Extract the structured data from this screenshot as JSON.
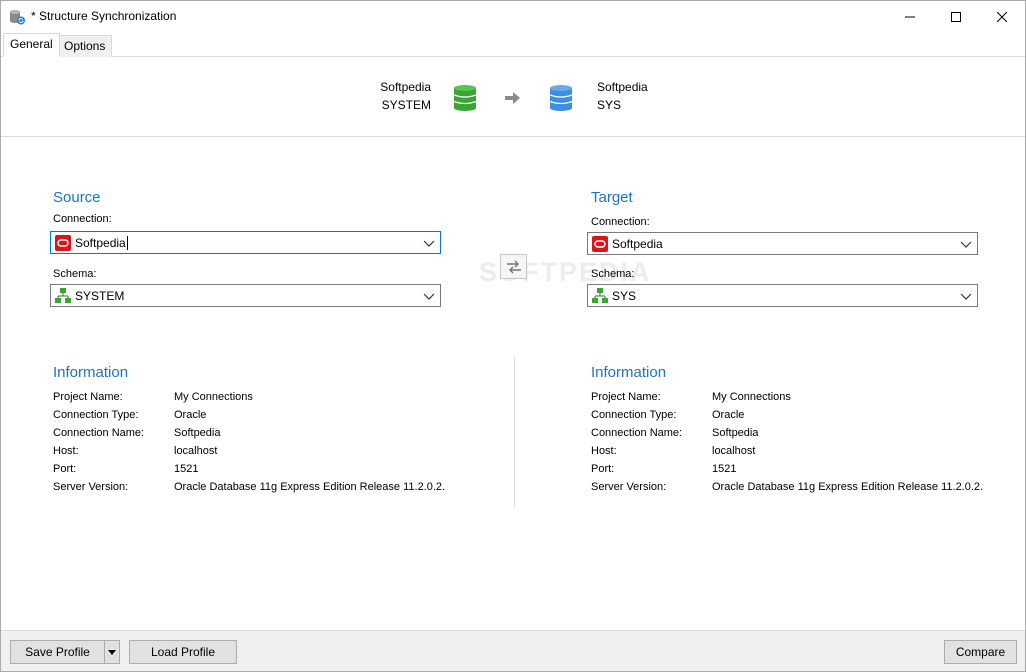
{
  "window": {
    "title": "* Structure Synchronization"
  },
  "tabs": [
    {
      "label": "General",
      "active": true
    },
    {
      "label": "Options",
      "active": false
    }
  ],
  "header": {
    "source_connection": "Softpedia",
    "source_schema": "SYSTEM",
    "target_connection": "Softpedia",
    "target_schema": "SYS"
  },
  "source": {
    "title": "Source",
    "connection_label": "Connection:",
    "connection_value": "Softpedia",
    "schema_label": "Schema:",
    "schema_value": "SYSTEM"
  },
  "target": {
    "title": "Target",
    "connection_label": "Connection:",
    "connection_value": "Softpedia",
    "schema_label": "Schema:",
    "schema_value": "SYS"
  },
  "source_info": {
    "title": "Information",
    "rows": [
      {
        "label": "Project Name:",
        "value": "My Connections"
      },
      {
        "label": "Connection Type:",
        "value": "Oracle"
      },
      {
        "label": "Connection Name:",
        "value": "Softpedia"
      },
      {
        "label": "Host:",
        "value": "localhost"
      },
      {
        "label": "Port:",
        "value": "1521"
      },
      {
        "label": "Server Version:",
        "value": "Oracle Database 11g Express Edition Release 11.2.0.2."
      }
    ]
  },
  "target_info": {
    "title": "Information",
    "rows": [
      {
        "label": "Project Name:",
        "value": "My Connections"
      },
      {
        "label": "Connection Type:",
        "value": "Oracle"
      },
      {
        "label": "Connection Name:",
        "value": "Softpedia"
      },
      {
        "label": "Host:",
        "value": "localhost"
      },
      {
        "label": "Port:",
        "value": "1521"
      },
      {
        "label": "Server Version:",
        "value": "Oracle Database 11g Express Edition Release 11.2.0.2."
      }
    ]
  },
  "watermark": "SOFTPEDIA",
  "footer": {
    "save_profile": "Save Profile",
    "load_profile": "Load Profile",
    "compare": "Compare"
  },
  "colors": {
    "accent": "#1e73be",
    "source_db": "#3aa534",
    "target_db": "#3d8fe0",
    "oracle": "#d9141b"
  },
  "icons": {
    "app": "database-sync-icon",
    "source_db": "database-green-icon",
    "target_db": "database-blue-icon",
    "arrow": "arrow-right-icon",
    "swap": "swap-arrows-icon",
    "oracle": "oracle-icon",
    "schema": "schema-tree-icon"
  }
}
